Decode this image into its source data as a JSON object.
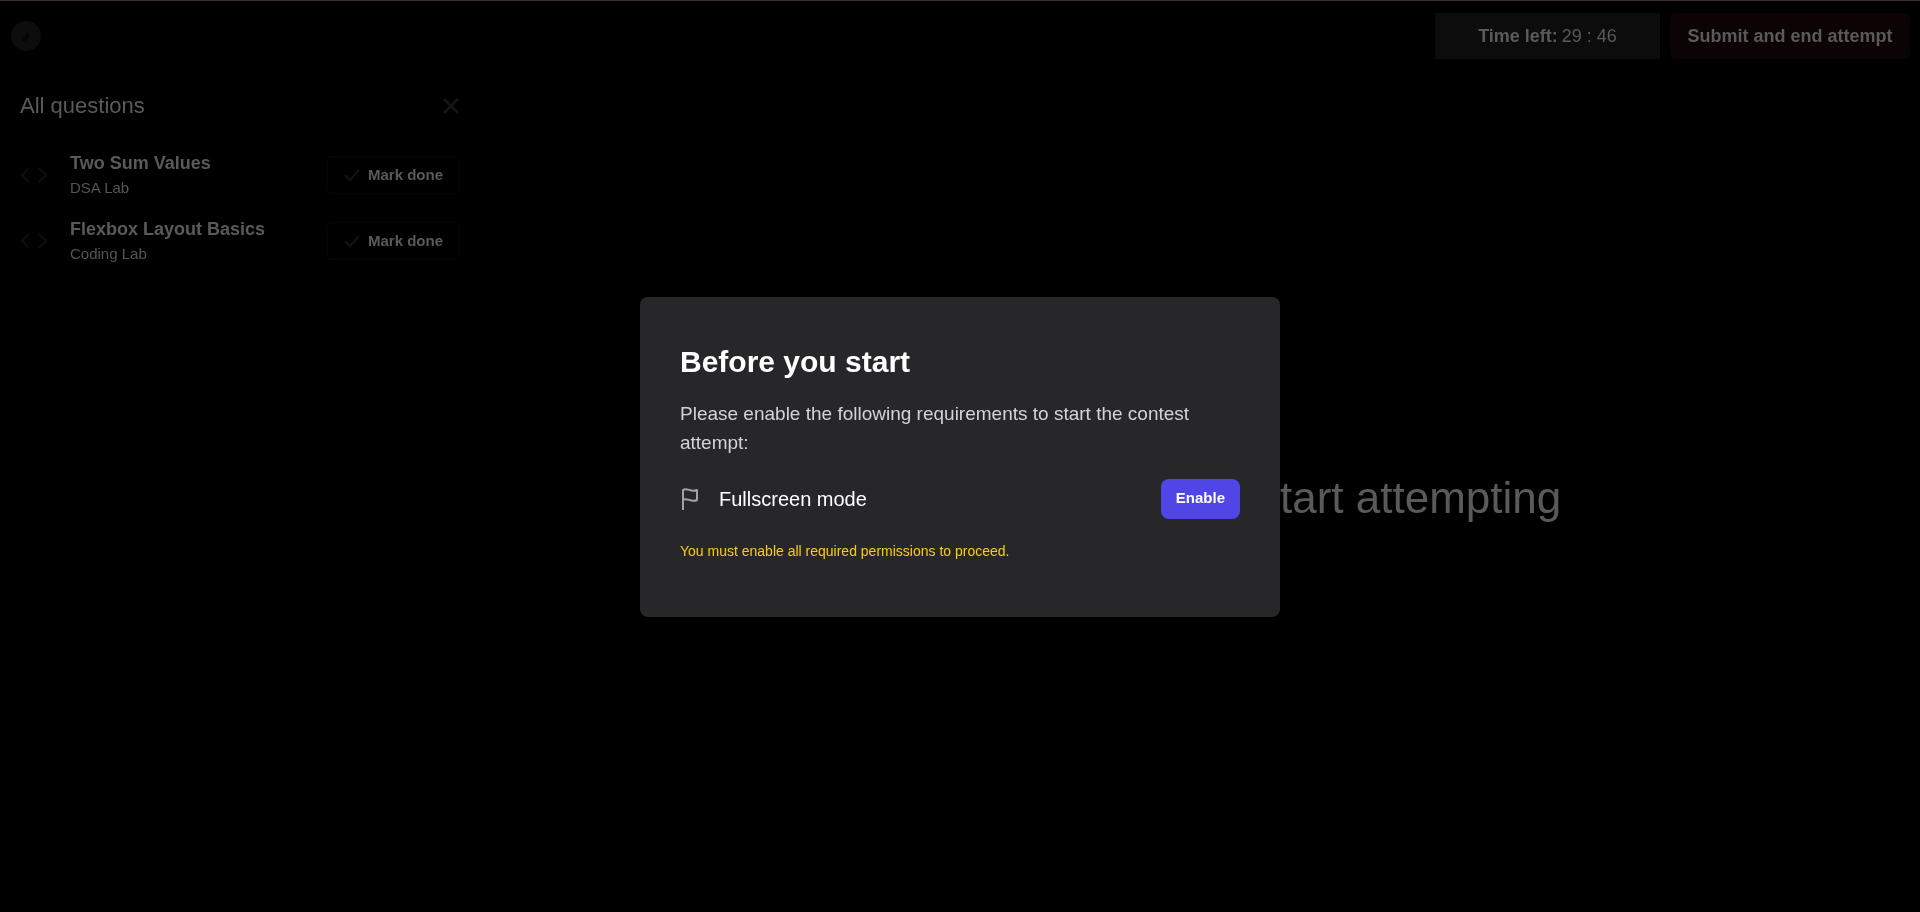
{
  "header": {
    "timer_label": "Time left:",
    "timer_value": "29 : 46",
    "submit_button": "Submit and end attempt"
  },
  "sidebar": {
    "title": "All questions",
    "items": [
      {
        "title": "Two Sum Values",
        "subtitle": "DSA Lab",
        "action": "Mark done"
      },
      {
        "title": "Flexbox Layout Basics",
        "subtitle": "Coding Lab",
        "action": "Mark done"
      }
    ]
  },
  "background_text": "tart attempting",
  "dialog": {
    "title": "Before you start",
    "description": "Please enable the following requirements to start the contest attempt:",
    "requirements": [
      {
        "label": "Fullscreen mode",
        "button": "Enable"
      }
    ],
    "warning": "You must enable all required permissions to proceed."
  }
}
